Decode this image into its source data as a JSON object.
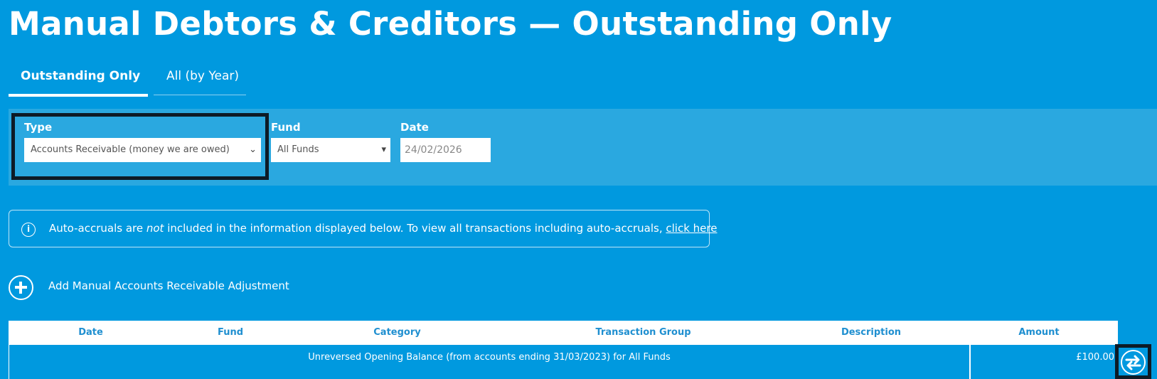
{
  "page": {
    "title": "Manual Debtors & Creditors — Outstanding Only"
  },
  "tabs": [
    {
      "label": "Outstanding Only",
      "active": true
    },
    {
      "label": "All (by Year)",
      "active": false
    }
  ],
  "filters": {
    "type": {
      "label": "Type",
      "value": "Accounts Receivable (money we are owed)"
    },
    "fund": {
      "label": "Fund",
      "value": "All Funds"
    },
    "date": {
      "label": "Date",
      "value": "24/02/2026"
    }
  },
  "info": {
    "icon": "info-icon",
    "text_before": "Auto-accruals are ",
    "text_emphasis": "not",
    "text_after": " included in the information displayed below. To view all transactions including auto-accruals, ",
    "link_text": "click here"
  },
  "add_adjustment": {
    "icon": "plus-circle-icon",
    "label": "Add Manual Accounts Receivable Adjustment"
  },
  "table": {
    "columns": [
      "Date",
      "Fund",
      "Category",
      "Transaction Group",
      "Description",
      "Amount"
    ],
    "rows": [
      {
        "summary": "Unreversed Opening Balance (from accounts ending 31/03/2023) for All Funds",
        "amount": "£100.00"
      }
    ]
  },
  "row_action": {
    "icon": "swap-arrows-icon"
  },
  "colors": {
    "background": "#0099df",
    "panel": "#2aa8e0",
    "header_text": "#1f8fd0",
    "highlight_border": "#0d1b26"
  }
}
